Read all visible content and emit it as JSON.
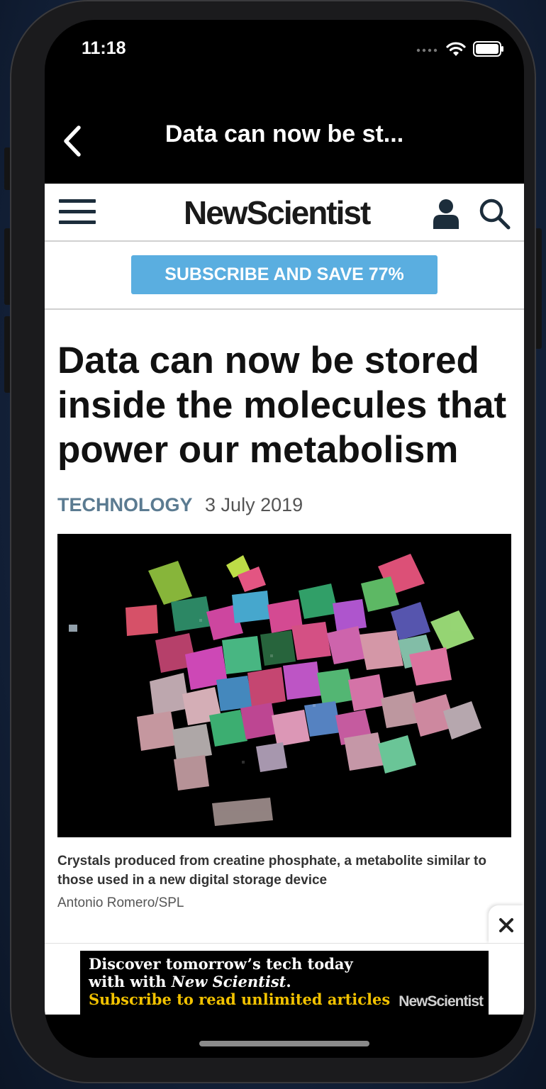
{
  "status_bar": {
    "time": "11:18"
  },
  "nav": {
    "title": "Data can now be st..."
  },
  "site": {
    "logo": "NewScientist",
    "subscribe_label": "SUBSCRIBE AND SAVE 77%"
  },
  "article": {
    "headline": "Data can now be stored inside the molecules that power our metabolism",
    "category": "TECHNOLOGY",
    "date": "3 July 2019",
    "caption": "Crystals produced from creatine phosphate, a metabolite similar to those used in a new digital storage device",
    "credit": "Antonio Romero/SPL"
  },
  "ad": {
    "line1": "Discover tomorrow’s tech today",
    "line2_prefix": "with with ",
    "line2_brand": "New Scientist",
    "line2_suffix": ".",
    "line3": "Subscribe to read unlimited articles",
    "logo": "NewScientist"
  },
  "colors": {
    "subscribe": "#5aaee0",
    "category": "#5b7b91",
    "ad_highlight": "#f2c200"
  },
  "icons": [
    "back-chevron-icon",
    "hamburger-menu-icon",
    "user-icon",
    "search-icon",
    "close-icon",
    "wifi-icon",
    "battery-icon",
    "signal-icon"
  ]
}
